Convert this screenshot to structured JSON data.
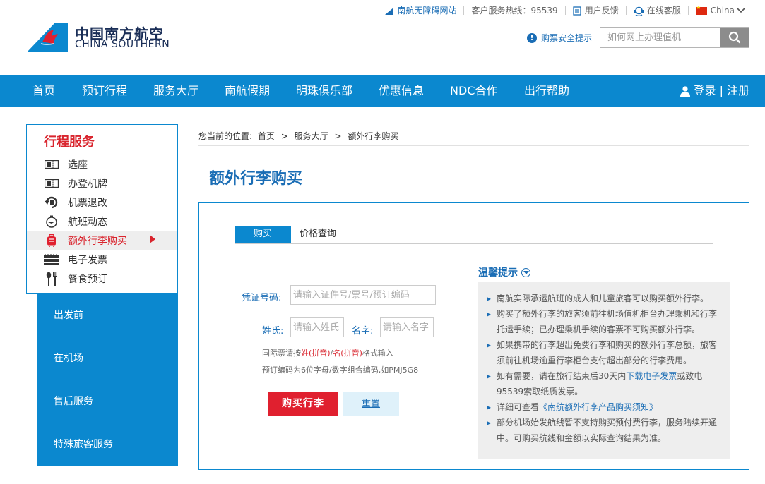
{
  "topbar": {
    "accessible_site": "南航无障碍网站",
    "hotline_label": "客户服务热线：",
    "hotline_number": "95539",
    "feedback": "用户反馈",
    "online_service": "在线客服",
    "region": "China"
  },
  "logo": {
    "cn": "中国南方航空",
    "en": "CHINA SOUTHERN"
  },
  "security_tip": "购票安全提示",
  "search": {
    "placeholder": "如何网上办理值机"
  },
  "nav": {
    "items": [
      "首页",
      "预订行程",
      "服务大厅",
      "南航假期",
      "明珠俱乐部",
      "优惠信息",
      "NDC合作",
      "出行帮助"
    ],
    "login": "登录",
    "divider": "|",
    "register": "注册"
  },
  "sidebar": {
    "title": "行程服务",
    "items": [
      {
        "label": "选座",
        "icon": "seat-ticket-icon"
      },
      {
        "label": "办登机牌",
        "icon": "boarding-pass-icon"
      },
      {
        "label": "机票退改",
        "icon": "refund-change-icon"
      },
      {
        "label": "航班动态",
        "icon": "flight-status-icon"
      },
      {
        "label": "额外行李购买",
        "icon": "luggage-icon"
      },
      {
        "label": "电子发票",
        "icon": "invoice-icon"
      },
      {
        "label": "餐食预订",
        "icon": "meal-icon"
      }
    ],
    "sections": [
      "出发前",
      "在机场",
      "售后服务",
      "特殊旅客服务"
    ]
  },
  "breadcrumb": {
    "prefix": "您当前的位置:",
    "items": [
      "首页",
      "服务大厅",
      "额外行李购买"
    ],
    "sep": ">"
  },
  "page_title": "额外行李购买",
  "tabs": {
    "buy": "购买",
    "price": "价格查询"
  },
  "form": {
    "voucher_label": "凭证号码:",
    "voucher_placeholder": "请输入证件号/票号/预订编码",
    "surname_label": "姓氏:",
    "surname_placeholder": "请输入姓氏",
    "given_label": "名字:",
    "given_placeholder": "请输入名字",
    "hint1_a": "国际票请按",
    "hint1_b": "姓(拼音)",
    "hint1_c": "/",
    "hint1_d": "名(拼音)",
    "hint1_e": "格式输入",
    "hint2": "预订编码为6位字母/数字组合编码,如PMJ5G8",
    "buy_button": "购买行李",
    "reset_button": "重置"
  },
  "tips": {
    "title": "温馨提示",
    "t1": "南航实际承运航班的成人和儿童旅客可以购买额外行李。",
    "t2": "购买了额外行李的旅客须前往机场值机柜台办理乘机和行李托运手续；已办理乘机手续的客票不可购买额外行李。",
    "t3": "如果携带的行李超出免费行李和购买的额外行李总额，旅客须前往机场逾重行李柜台支付超出部分的行李费用。",
    "t4_a": "如有需要，请在旅行结束后30天内",
    "t4_link": "下载电子发票",
    "t4_b": "或致电95539索取纸质发票。",
    "t5_a": "详细可查看",
    "t5_link": "《南航额外行李产品购买须知》",
    "t6": "部分机场始发航线暂不支持购买预付费行李，服务陆续开通中。可购买航线和金额以实际查询结果为准。"
  },
  "colors": {
    "brand_blue": "#0b88cf",
    "link_blue": "#1a6db5",
    "accent_red": "#d9252e",
    "buy_red": "#e0202f"
  }
}
